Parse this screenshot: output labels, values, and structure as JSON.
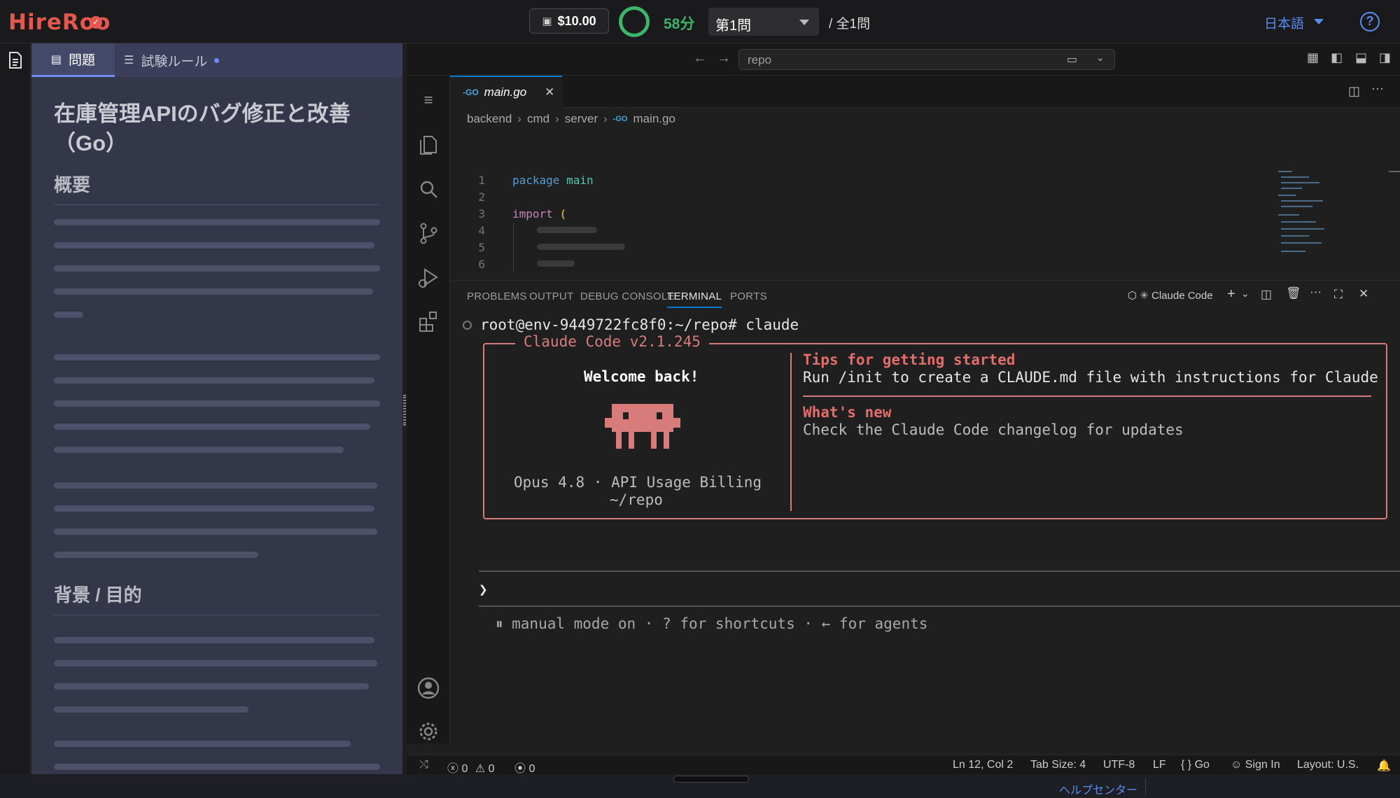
{
  "topbar": {
    "logo": "HireRoo",
    "budget": "$10.00",
    "timer": "58分",
    "question_select": "第1問",
    "question_total": "/ 全1問",
    "language": "日本語"
  },
  "problem_panel": {
    "tabs": [
      {
        "label": "問題"
      },
      {
        "label": "試験ルール"
      }
    ],
    "title": "在庫管理APIのバグ修正と改善（Go）",
    "sections": [
      "概要",
      "背景 / 目的"
    ]
  },
  "vscode": {
    "command_center": "repo",
    "tab": {
      "label": "main.go"
    },
    "breadcrumb": [
      "backend",
      "cmd",
      "server",
      "main.go"
    ],
    "code": [
      {
        "n": "1",
        "text": "package main"
      },
      {
        "n": "2",
        "text": ""
      },
      {
        "n": "3",
        "text": "import ("
      },
      {
        "n": "4",
        "text": ""
      },
      {
        "n": "5",
        "text": ""
      },
      {
        "n": "6",
        "text": ""
      }
    ],
    "panel_tabs": [
      "PROBLEMS",
      "OUTPUT",
      "DEBUG CONSOLE",
      "TERMINAL",
      "PORTS"
    ],
    "terminal_name": "Claude Code",
    "terminal": {
      "prompt": "root@env-9449722fc8f0:~/repo# claude",
      "box_title": "Claude Code v2.1.245",
      "welcome": "Welcome back!",
      "model": "Opus 4.8 · API Usage Billing",
      "cwd": "~/repo",
      "tips_heading": "Tips for getting started",
      "tips_text": "Run /init to create a CLAUDE.md file with instructions for Claude",
      "whats_new_heading": "What's new",
      "whats_new_text": "Check the Claude Code changelog for updates",
      "input_prompt": "❯",
      "hint": "⏸ manual mode on · ? for shortcuts · ← for agents"
    },
    "status": {
      "errors": "0",
      "warnings": "0",
      "ports": "0",
      "position": "Ln 12, Col 2",
      "tab_size": "Tab Size: 4",
      "encoding": "UTF-8",
      "eol": "LF",
      "language": "Go",
      "sign_in": "Sign In",
      "layout": "Layout: U.S."
    }
  },
  "footer": {
    "help_center": "ヘルプセンター"
  },
  "colors": {
    "accent": "#0078d4",
    "claude": "#d77b7b",
    "timer": "#3bb56a",
    "link": "#5a8cf0"
  }
}
